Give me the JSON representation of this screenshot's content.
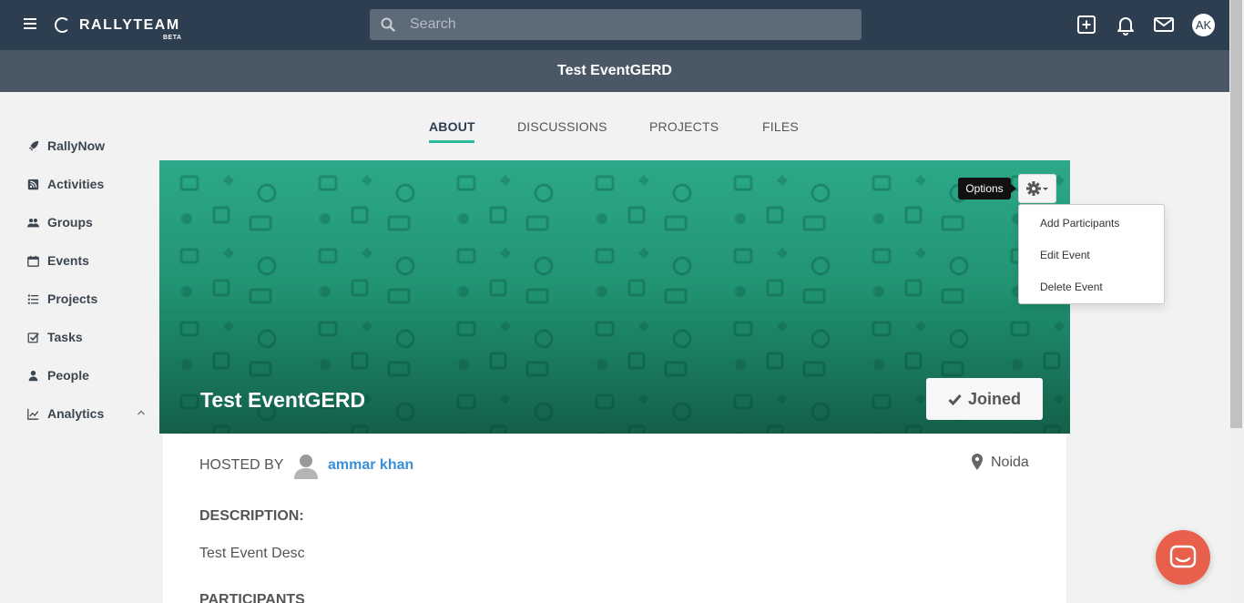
{
  "header": {
    "brand": "RALLYTEAM",
    "brand_sub": "BETA",
    "search_placeholder": "Search",
    "avatar_initials": "AK",
    "icons": [
      "menu-icon",
      "search-icon",
      "add-icon",
      "bell-icon",
      "mail-icon"
    ]
  },
  "event_title": "Test EventGERD",
  "sidebar": {
    "items": [
      {
        "label": "RallyNow",
        "icon": "rocket-icon"
      },
      {
        "label": "Activities",
        "icon": "rss-icon"
      },
      {
        "label": "Groups",
        "icon": "users-icon"
      },
      {
        "label": "Events",
        "icon": "calendar-icon"
      },
      {
        "label": "Projects",
        "icon": "list-icon"
      },
      {
        "label": "Tasks",
        "icon": "check-square-icon"
      },
      {
        "label": "People",
        "icon": "user-icon"
      },
      {
        "label": "Analytics",
        "icon": "line-chart-icon"
      }
    ]
  },
  "tabs": [
    "ABOUT",
    "DISCUSSIONS",
    "PROJECTS",
    "FILES"
  ],
  "active_tab": "ABOUT",
  "banner": {
    "title": "Test EventGERD",
    "joined_label": "Joined",
    "options_tooltip": "Options"
  },
  "options_menu": [
    "Add Participants",
    "Edit Event",
    "Delete Event"
  ],
  "details": {
    "hosted_by_label": "HOSTED BY",
    "host_name": "ammar khan",
    "location": "Noida",
    "description_heading": "DESCRIPTION:",
    "description": "Test Event Desc",
    "participants_heading": "PARTICIPANTS"
  },
  "colors": {
    "topbar": "#2c3e50",
    "accent": "#2bbd9a",
    "banner": "#219474",
    "link": "#3a8fd6",
    "chat": "#e8604c"
  }
}
